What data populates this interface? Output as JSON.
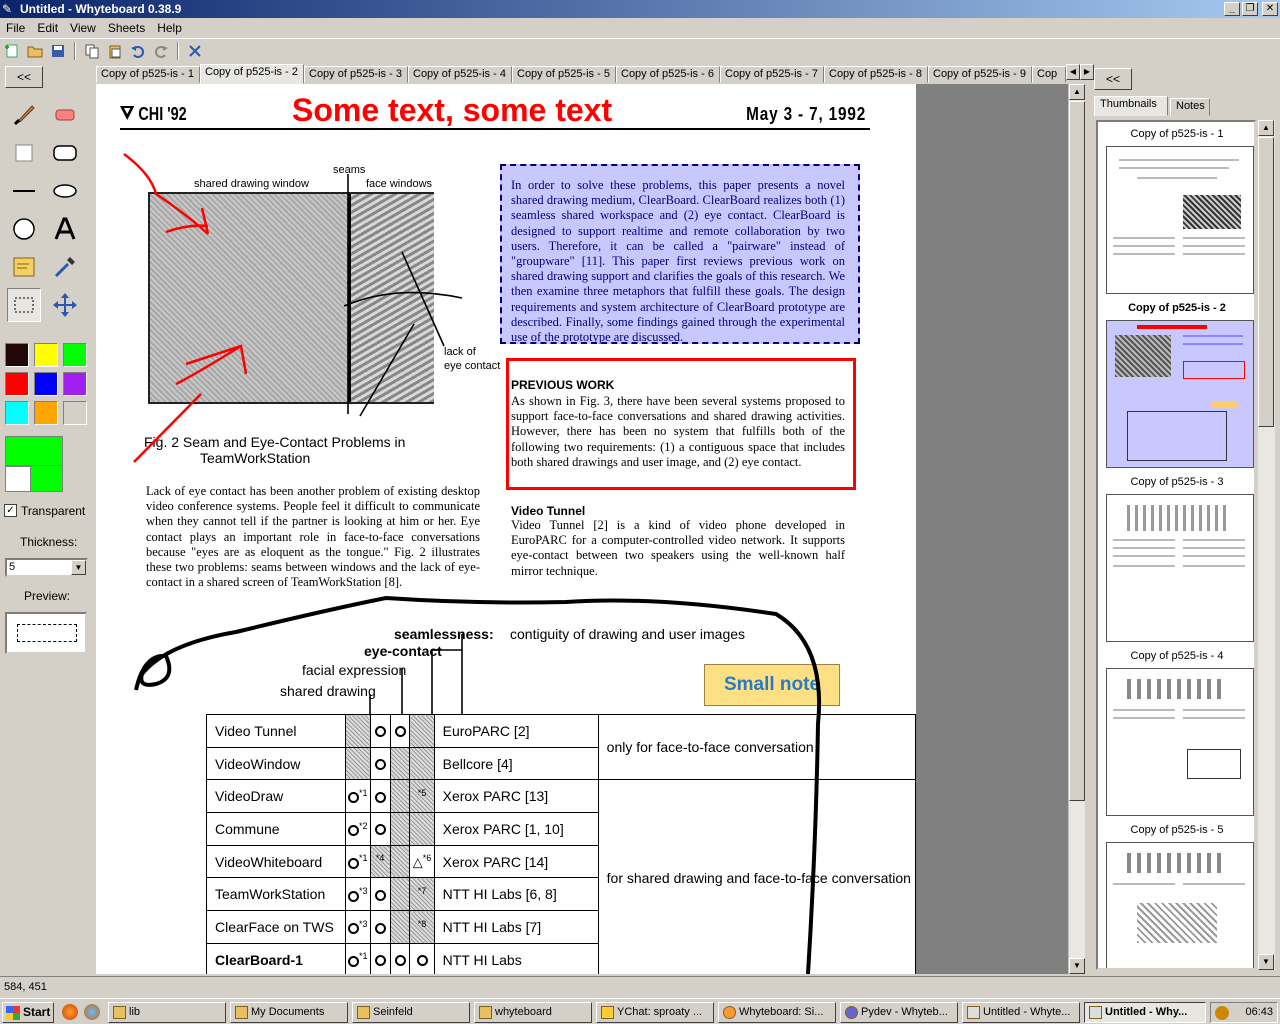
{
  "window": {
    "title": "Untitled - Whyteboard 0.38.9",
    "buttons": {
      "minimize": "_",
      "maximize": "❐",
      "close": "✕"
    }
  },
  "menu": [
    "File",
    "Edit",
    "View",
    "Sheets",
    "Help"
  ],
  "left_panel": {
    "collapse": "<<",
    "transparent_label": "Transparent",
    "thickness_label": "Thickness:",
    "thickness_value": "5",
    "preview_label": "Preview:",
    "palette": [
      "#200808",
      "#ffff00",
      "#00ff00",
      "#ff0000",
      "#0000ff",
      "#a020f0",
      "#00ffff",
      "#ffa500",
      "#d4d0c8"
    ],
    "foreground": "#00ff00",
    "background": "#ffffff"
  },
  "tabs": [
    "Copy of p525-is - 1",
    "Copy of p525-is - 2",
    "Copy of p525-is - 3",
    "Copy of p525-is - 4",
    "Copy of p525-is - 5",
    "Copy of p525-is - 6",
    "Copy of p525-is - 7",
    "Copy of p525-is - 8",
    "Copy of p525-is - 9",
    "Cop"
  ],
  "active_tab": 1,
  "page": {
    "header_left": "CHI '92",
    "header_right": "May 3 - 7, 1992",
    "big_text": "Some text, some text",
    "fig_labels": {
      "seams": "seams",
      "shared_window": "shared drawing window",
      "face_windows": "face windows",
      "lack1": "lack of",
      "lack2": "eye contact"
    },
    "fig_caption_1": "Fig. 2    Seam and Eye-Contact Problems in",
    "fig_caption_2": "TeamWorkStation",
    "blue_text": "In order to solve these problems, this paper presents a novel shared drawing medium, ClearBoard. ClearBoard realizes both (1) seamless shared workspace and (2) eye contact. ClearBoard is designed to support realtime and remote collaboration by two users. Therefore, it can be called a \"pairware\" instead of \"groupware\" [11]. This paper first reviews previous work on shared drawing support and clarifies the goals of this research. We then examine three metaphors that fulfill these goals. The design requirements and system architecture of ClearBoard prototype are described. Finally, some findings gained through the experimental use of the prototype are discussed.",
    "pw_heading": "PREVIOUS WORK",
    "pw_text": "As shown in Fig. 3, there have been several systems proposed to support face-to-face conversations and shared drawing activities. However, there has been no system that fulfills both of the following two requirements: (1) a contiguous space that includes both shared drawings and user image, and (2) eye contact.",
    "vt_heading": "Video Tunnel",
    "vt_text": "Video Tunnel [2] is a kind of video phone developed in EuroPARC for a computer-controlled video network. It supports eye-contact between two speakers using the well-known half mirror technique.",
    "left_para": "Lack of eye contact has been another problem of existing desktop video conference systems. People feel it difficult to communicate when they cannot tell if the partner is looking at him or her. Eye contact plays an important role in face-to-face conversations because \"eyes are as eloquent as the tongue.\" Fig. 2 illustrates these two problems: seams between windows and the lack of eye-contact in a shared screen of TeamWorkStation [8].",
    "note": "Small note",
    "table_labels": {
      "seamlessness": "seamlessness:",
      "seamlessness_desc": "contiguity of drawing and user images",
      "eye_contact": "eye-contact",
      "facial": "facial expression",
      "shared": "shared drawing"
    },
    "table_rows": [
      {
        "name": "Video Tunnel",
        "org": "EuroPARC [2]"
      },
      {
        "name": "VideoWindow",
        "org": "Bellcore [4]"
      },
      {
        "name": "VideoDraw",
        "org": "Xerox PARC [13]"
      },
      {
        "name": "Commune",
        "org": "Xerox PARC [1, 10]"
      },
      {
        "name": "VideoWhiteboard",
        "org": "Xerox PARC [14]"
      },
      {
        "name": "TeamWorkStation",
        "org": "NTT HI Labs [6, 8]"
      },
      {
        "name": "ClearFace on TWS",
        "org": "NTT HI Labs [7]"
      },
      {
        "name": "ClearBoard-1",
        "org": "NTT HI Labs"
      }
    ],
    "table_right_1": "only for face-to-face conversation",
    "table_right_2": "for shared drawing and face-to-face conversation",
    "footnotes": {
      "f1": "*1",
      "f2": "*2",
      "f3": "*3",
      "f4": "*4",
      "f5": "*5",
      "f6": "*6",
      "f7": "*7",
      "f8": "*8"
    }
  },
  "right_panel": {
    "collapse": "<<",
    "tab_thumbnails": "Thumbnails",
    "tab_notes": "Notes",
    "thumbs": [
      "Copy of p525-is - 1",
      "Copy of p525-is - 2",
      "Copy of p525-is - 3",
      "Copy of p525-is - 4",
      "Copy of p525-is - 5"
    ],
    "selected_thumb": 1
  },
  "status": "584, 451",
  "taskbar": {
    "start": "Start",
    "tasks": [
      "lib",
      "My Documents",
      "Seinfeld",
      "whyteboard",
      "YChat: sproaty ...",
      "Whyteboard: Si...",
      "Pydev - Whyteb...",
      "Untitled - Whyte...",
      "Untitled - Why..."
    ],
    "active_task": 8,
    "clock": "06:43"
  }
}
